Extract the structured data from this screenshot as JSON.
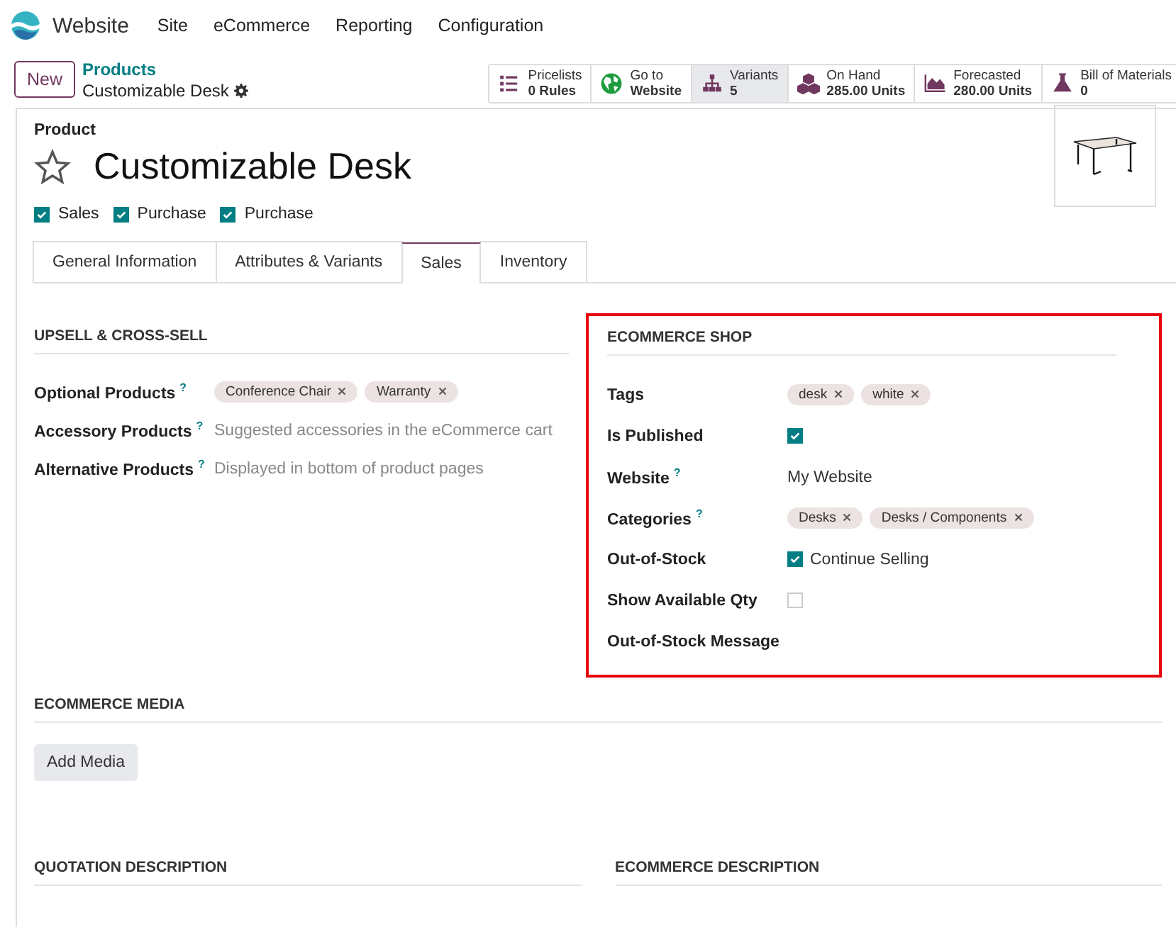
{
  "navbar": {
    "app": "Website",
    "menus": [
      "Site",
      "eCommerce",
      "Reporting",
      "Configuration"
    ]
  },
  "control_panel": {
    "new_button": "New",
    "breadcrumb": "Products",
    "record": "Customizable Desk"
  },
  "smart_buttons": [
    {
      "title": "Pricelists",
      "value": "0 Rules",
      "selected": false
    },
    {
      "title": "Go to",
      "value": "Website",
      "selected": false
    },
    {
      "title": "Variants",
      "value": "5",
      "selected": true
    },
    {
      "title": "On Hand",
      "value": "285.00 Units",
      "selected": false
    },
    {
      "title": "Forecasted",
      "value": "280.00 Units",
      "selected": false
    },
    {
      "title": "Bill of Materials",
      "value": "0",
      "selected": false
    }
  ],
  "product": {
    "label": "Product",
    "name": "Customizable Desk",
    "favorite": false,
    "options": [
      {
        "label": "Sales",
        "checked": true
      },
      {
        "label": "Purchase",
        "checked": true
      },
      {
        "label": "Purchase",
        "checked": true
      }
    ]
  },
  "tabs": [
    {
      "label": "General Information",
      "selected": false
    },
    {
      "label": "Attributes & Variants",
      "selected": false
    },
    {
      "label": "Sales",
      "selected": true
    },
    {
      "label": "Inventory",
      "selected": false
    }
  ],
  "upsell": {
    "title": "UPSELL & CROSS-SELL",
    "fields": [
      {
        "kind": "tags",
        "label": "Optional Products",
        "help": "?",
        "tags": [
          "Conference Chair",
          "Warranty"
        ]
      },
      {
        "kind": "placeholder",
        "label": "Accessory Products",
        "help": "?",
        "placeholder": "Suggested accessories in the eCommerce cart"
      },
      {
        "kind": "placeholder",
        "label": "Alternative Products",
        "help": "?",
        "placeholder": "Displayed in bottom of product pages"
      }
    ]
  },
  "ecommerce_shop": {
    "title": "ECOMMERCE SHOP",
    "highlighted": true,
    "fields": [
      {
        "kind": "tags",
        "label": "Tags",
        "tags": [
          "desk",
          "white"
        ]
      },
      {
        "kind": "checkbox",
        "label": "Is Published",
        "checked": true
      },
      {
        "kind": "text",
        "label": "Website",
        "help": "?",
        "value": "My Website"
      },
      {
        "kind": "tags",
        "label": "Categories",
        "help": "?",
        "tags": [
          "Desks",
          "Desks / Components"
        ]
      },
      {
        "kind": "checkbox",
        "label": "Out-of-Stock",
        "checked": true,
        "text": "Continue Selling"
      },
      {
        "kind": "checkbox",
        "label": "Show Available Qty",
        "checked": false
      },
      {
        "kind": "empty",
        "label": "Out-of-Stock Message"
      }
    ]
  },
  "ecommerce_media": {
    "title": "ECOMMERCE MEDIA",
    "button": "Add Media"
  },
  "descriptions": [
    "QUOTATION DESCRIPTION",
    "ECOMMERCE DESCRIPTION"
  ]
}
